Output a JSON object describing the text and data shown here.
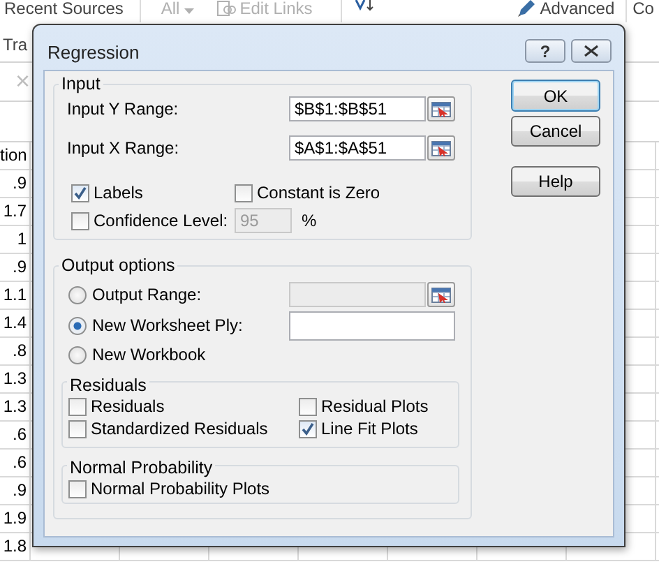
{
  "ribbon": {
    "items": [
      {
        "kind": "text",
        "label": "Recent Sources",
        "disabled": false
      },
      {
        "kind": "dropdown",
        "label": "All",
        "disabled": true
      },
      {
        "kind": "link",
        "label": "Edit Links",
        "disabled": true
      },
      {
        "kind": "sort",
        "disabled": false
      },
      {
        "kind": "edit",
        "label": "Advanced",
        "disabled": false
      },
      {
        "kind": "text",
        "label": "Co",
        "disabled": false
      }
    ],
    "second_row": "Tra"
  },
  "formula_bar": {
    "cancel_glyph": "×"
  },
  "sheet": {
    "column_1": [
      "tion",
      ".9",
      "1.7",
      "1",
      ".9",
      "1.1",
      "1.4",
      ".8",
      "1.3",
      "1.3",
      ".6",
      ".6",
      ".9",
      "1.9",
      "1.8"
    ]
  },
  "dialog": {
    "title": "Regression",
    "help_glyph": "?",
    "input": {
      "title": "Input",
      "ranges": [
        {
          "label": "Input Y Range:",
          "value": "$B$1:$B$51"
        },
        {
          "label": "Input X Range:",
          "value": "$A$1:$A$51"
        }
      ],
      "labels": {
        "label": "Labels",
        "checked": true
      },
      "constant_zero": {
        "label": "Constant is Zero",
        "checked": false
      },
      "confidence": {
        "label": "Confidence Level:",
        "checked": false,
        "value": "95",
        "unit": "%"
      }
    },
    "output": {
      "title": "Output options",
      "destinations": [
        {
          "kind": "range",
          "label": "Output Range:",
          "selected": false
        },
        {
          "kind": "text",
          "label": "New Worksheet Ply:",
          "selected": true
        },
        {
          "kind": "none",
          "label": "New Workbook",
          "selected": false
        }
      ],
      "residuals": {
        "title": "Residuals",
        "options": [
          {
            "label": "Residuals",
            "checked": false
          },
          {
            "label": "Residual Plots",
            "checked": false
          },
          {
            "label": "Standardized Residuals",
            "checked": false
          },
          {
            "label": "Line Fit Plots",
            "checked": true
          }
        ]
      },
      "normal": {
        "title": "Normal Probability",
        "options": [
          {
            "label": "Normal Probability Plots",
            "checked": false
          }
        ]
      }
    },
    "buttons": [
      {
        "label": "OK",
        "default": true
      },
      {
        "label": "Cancel",
        "default": false
      },
      {
        "label": "Help",
        "default": false
      }
    ]
  }
}
